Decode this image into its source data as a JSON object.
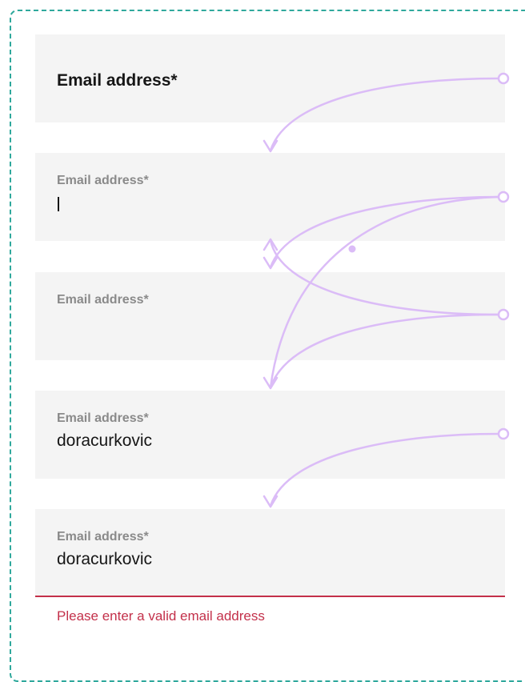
{
  "fields": [
    {
      "state": "default",
      "label": "Email address*"
    },
    {
      "state": "focused",
      "label": "Email address*",
      "cursor": "|"
    },
    {
      "state": "filled-empty",
      "label": "Email address*"
    },
    {
      "state": "filled",
      "label": "Email address*",
      "value": "doracurkovic"
    },
    {
      "state": "error",
      "label": "Email address*",
      "value": "doracurkovic",
      "error": "Please enter a valid email address"
    }
  ],
  "colors": {
    "frame_border": "#2fa89c",
    "field_bg": "#f4f4f4",
    "arrow": "#dbbcf7",
    "error": "#c3304a",
    "label_muted": "#8a8a8a"
  }
}
